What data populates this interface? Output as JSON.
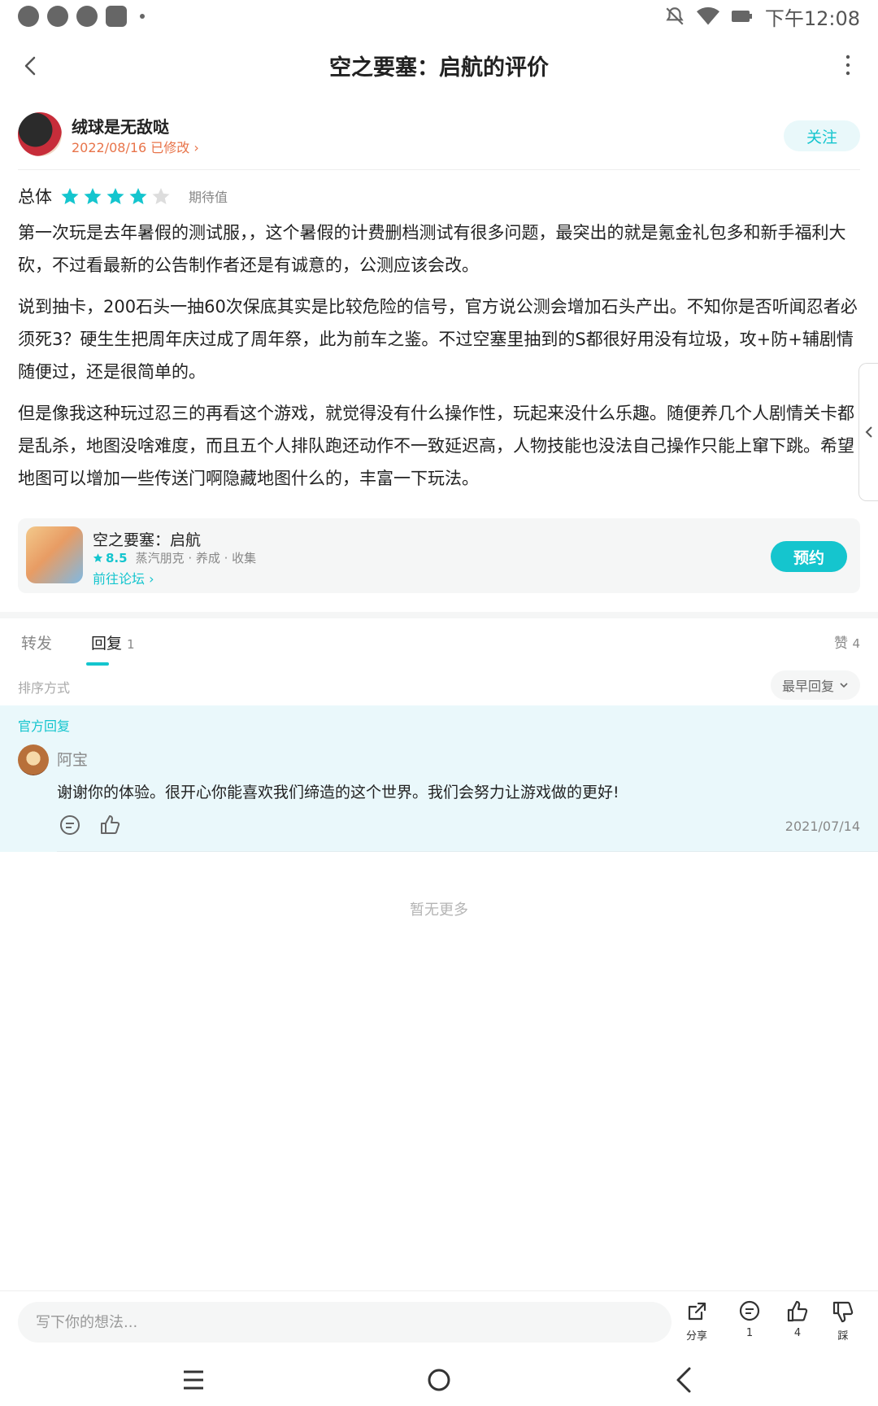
{
  "status_bar": {
    "time": "下午12:08"
  },
  "header": {
    "title": "空之要塞：启航的评价"
  },
  "author": {
    "name": "绒球是无敌哒",
    "date_modified": "2022/08/16 已修改",
    "follow_label": "关注"
  },
  "rating": {
    "label": "总体",
    "stars": 4,
    "max_stars": 5,
    "type": "期待值"
  },
  "review": {
    "paragraphs": [
      "第一次玩是去年暑假的测试服，，这个暑假的计费删档测试有很多问题，最突出的就是氪金礼包多和新手福利大砍，不过看最新的公告制作者还是有诚意的，公测应该会改。",
      "说到抽卡，200石头一抽60次保底其实是比较危险的信号，官方说公测会增加石头产出。不知你是否听闻忍者必须死3？硬生生把周年庆过成了周年祭，此为前车之鉴。不过空塞里抽到的S都很好用没有垃圾，攻+防+辅剧情随便过，还是很简单的。",
      "但是像我这种玩过忍三的再看这个游戏，就觉得没有什么操作性，玩起来没什么乐趣。随便养几个人剧情关卡都是乱杀，地图没啥难度，而且五个人排队跑还动作不一致延迟高，人物技能也没法自己操作只能上窜下跳。希望地图可以增加一些传送门啊隐藏地图什么的，丰富一下玩法。"
    ]
  },
  "game_card": {
    "name": "空之要塞：启航",
    "score": "8.5",
    "tags": "蒸汽朋克 · 养成 · 收集",
    "forum_link": "前往论坛",
    "reserve_label": "预约"
  },
  "tabs": {
    "forward": "转发",
    "reply": "回复",
    "reply_count": "1",
    "likes_label": "赞",
    "likes_count": "4"
  },
  "sort": {
    "label": "排序方式",
    "selected": "最早回复"
  },
  "official_reply": {
    "label": "官方回复",
    "name": "阿宝",
    "text": "谢谢你的体验。很开心你能喜欢我们缔造的这个世界。我们会努力让游戏做的更好!",
    "date": "2021/07/14"
  },
  "no_more": "暂无更多",
  "bottom_bar": {
    "input_placeholder": "写下你的想法...",
    "share_label": "分享",
    "comment_count": "1",
    "like_count": "4",
    "dislike_label": "踩"
  },
  "colors": {
    "accent": "#14c5ce",
    "date_orange": "#e8744a",
    "official_bg": "#eaf8fb"
  },
  "icons": {
    "back": "chevron-left-icon",
    "more": "more-vertical-icon",
    "star": "star-icon",
    "comment": "comment-icon",
    "like": "thumb-up-icon",
    "dislike": "thumb-down-icon",
    "share": "share-icon"
  }
}
